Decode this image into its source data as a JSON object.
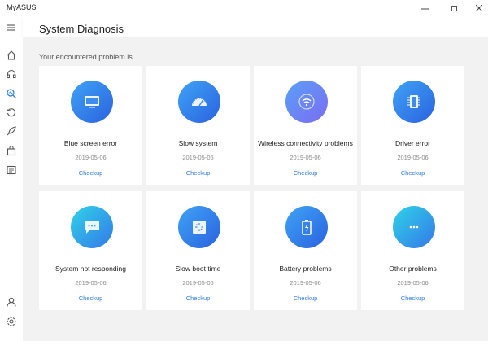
{
  "window": {
    "title": "MyASUS"
  },
  "header": {
    "title": "System Diagnosis"
  },
  "content": {
    "subtitle": "Your encountered problem is..."
  },
  "sidebar": {
    "items": [
      {
        "icon": "menu-icon"
      },
      {
        "icon": "home-icon"
      },
      {
        "icon": "headset-icon"
      },
      {
        "icon": "diagnosis-icon"
      },
      {
        "icon": "recovery-icon"
      },
      {
        "icon": "rocket-icon"
      },
      {
        "icon": "store-icon"
      },
      {
        "icon": "news-icon"
      },
      {
        "icon": "user-icon"
      },
      {
        "icon": "settings-icon"
      }
    ]
  },
  "cards": [
    {
      "title": "Blue screen error",
      "date": "2019-05-06",
      "action": "Checkup",
      "icon": "blue-screen-icon"
    },
    {
      "title": "Slow system",
      "date": "2019-05-06",
      "action": "Checkup",
      "icon": "speedometer-icon"
    },
    {
      "title": "Wireless connectivity problems",
      "date": "2019-05-06",
      "action": "Checkup",
      "icon": "wifi-icon"
    },
    {
      "title": "Driver error",
      "date": "2019-05-06",
      "action": "Checkup",
      "icon": "chip-icon"
    },
    {
      "title": "System not responding",
      "date": "2019-05-06",
      "action": "Checkup",
      "icon": "message-icon"
    },
    {
      "title": "Slow boot time",
      "date": "2019-05-06",
      "action": "Checkup",
      "icon": "loading-icon"
    },
    {
      "title": "Battery problems",
      "date": "2019-05-06",
      "action": "Checkup",
      "icon": "battery-icon"
    },
    {
      "title": "Other problems",
      "date": "2019-05-06",
      "action": "Checkup",
      "icon": "more-icon"
    }
  ],
  "colors": {
    "accent": "#2f7de0",
    "icon_gradient_blue": [
      "#3fa3f5",
      "#2a62e0"
    ],
    "icon_gradient_purple": [
      "#5aa0f7",
      "#7b6cf2"
    ],
    "icon_gradient_cyan": [
      "#2fd3e8",
      "#3478e8"
    ]
  }
}
